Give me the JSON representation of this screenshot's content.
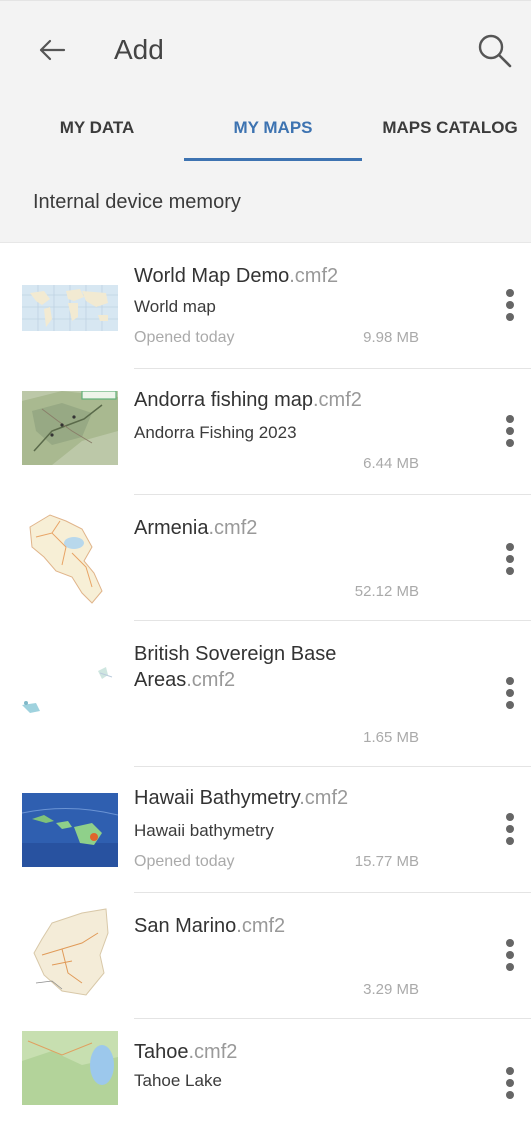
{
  "header": {
    "title": "Add",
    "back_icon": "arrow-left-icon",
    "search_icon": "search-icon"
  },
  "tabs": [
    {
      "label": "MY DATA",
      "active": false
    },
    {
      "label": "MY MAPS",
      "active": true
    },
    {
      "label": "MAPS CATALOG",
      "active": false
    }
  ],
  "section": {
    "label": "Internal device memory"
  },
  "colors": {
    "accent": "#3d73b1",
    "extension": "#999999",
    "meta": "#aaaaaa"
  },
  "maps": [
    {
      "name": "World Map Demo",
      "ext": ".cmf2",
      "desc": "World map",
      "opened": "Opened today",
      "size": "9.98 MB"
    },
    {
      "name": "Andorra fishing map",
      "ext": ".cmf2",
      "desc": "Andorra Fishing 2023",
      "opened": "",
      "size": "6.44 MB"
    },
    {
      "name": "Armenia",
      "ext": ".cmf2",
      "desc": "",
      "opened": "",
      "size": "52.12 MB"
    },
    {
      "name_line1": "British Sovereign Base",
      "name": "Areas",
      "ext": ".cmf2",
      "desc": "",
      "opened": "",
      "size": "1.65 MB"
    },
    {
      "name": "Hawaii Bathymetry",
      "ext": ".cmf2",
      "desc": "Hawaii bathymetry",
      "opened": "Opened today",
      "size": "15.77 MB"
    },
    {
      "name": "San Marino",
      "ext": ".cmf2",
      "desc": "",
      "opened": "",
      "size": "3.29 MB"
    },
    {
      "name": "Tahoe",
      "ext": ".cmf2",
      "desc": "Tahoe Lake",
      "opened": "",
      "size": ""
    }
  ]
}
